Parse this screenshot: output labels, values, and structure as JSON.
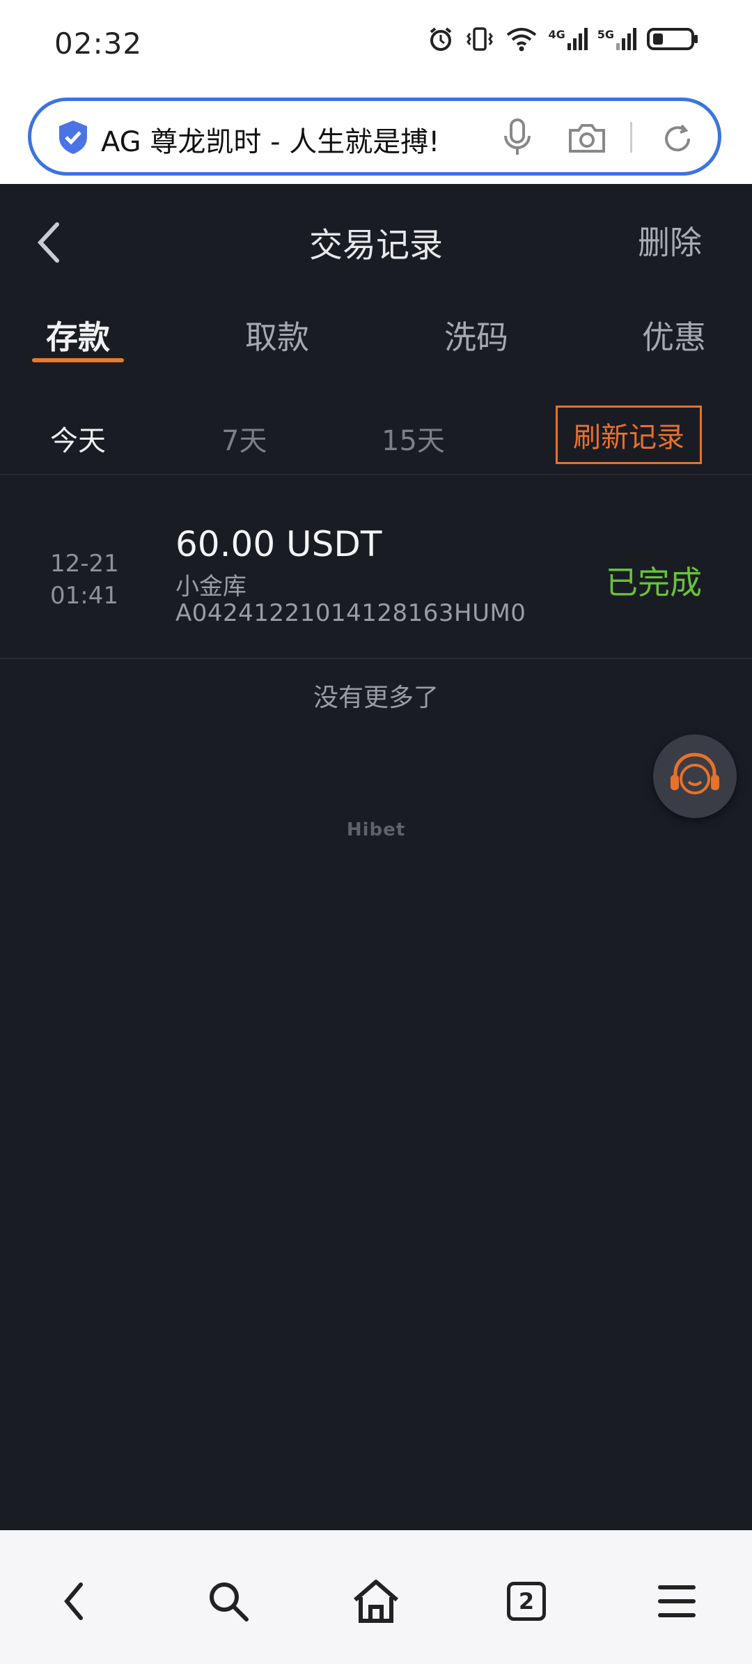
{
  "status_bar": {
    "time": "02:32",
    "net1": "4G",
    "net2": "5G"
  },
  "browser": {
    "url_title": "AG 尊龙凯时 - 人生就是搏!",
    "tab_count": "2"
  },
  "header": {
    "title": "交易记录",
    "delete_label": "删除"
  },
  "tabs": [
    {
      "label": "存款",
      "active": true
    },
    {
      "label": "取款"
    },
    {
      "label": "洗码"
    },
    {
      "label": "优惠"
    }
  ],
  "filters": {
    "today": "今天",
    "d7": "7天",
    "d15": "15天",
    "refresh": "刷新记录"
  },
  "records": [
    {
      "date": "12-21",
      "time": "01:41",
      "amount": "60.00 USDT",
      "channel": "小金库",
      "order_id": "A04241221014128163HUM0",
      "status": "已完成"
    }
  ],
  "no_more": "没有更多了",
  "brand": "Hibet",
  "colors": {
    "accent": "#e8712b",
    "success": "#6ac13b",
    "background": "#1a1c24"
  }
}
